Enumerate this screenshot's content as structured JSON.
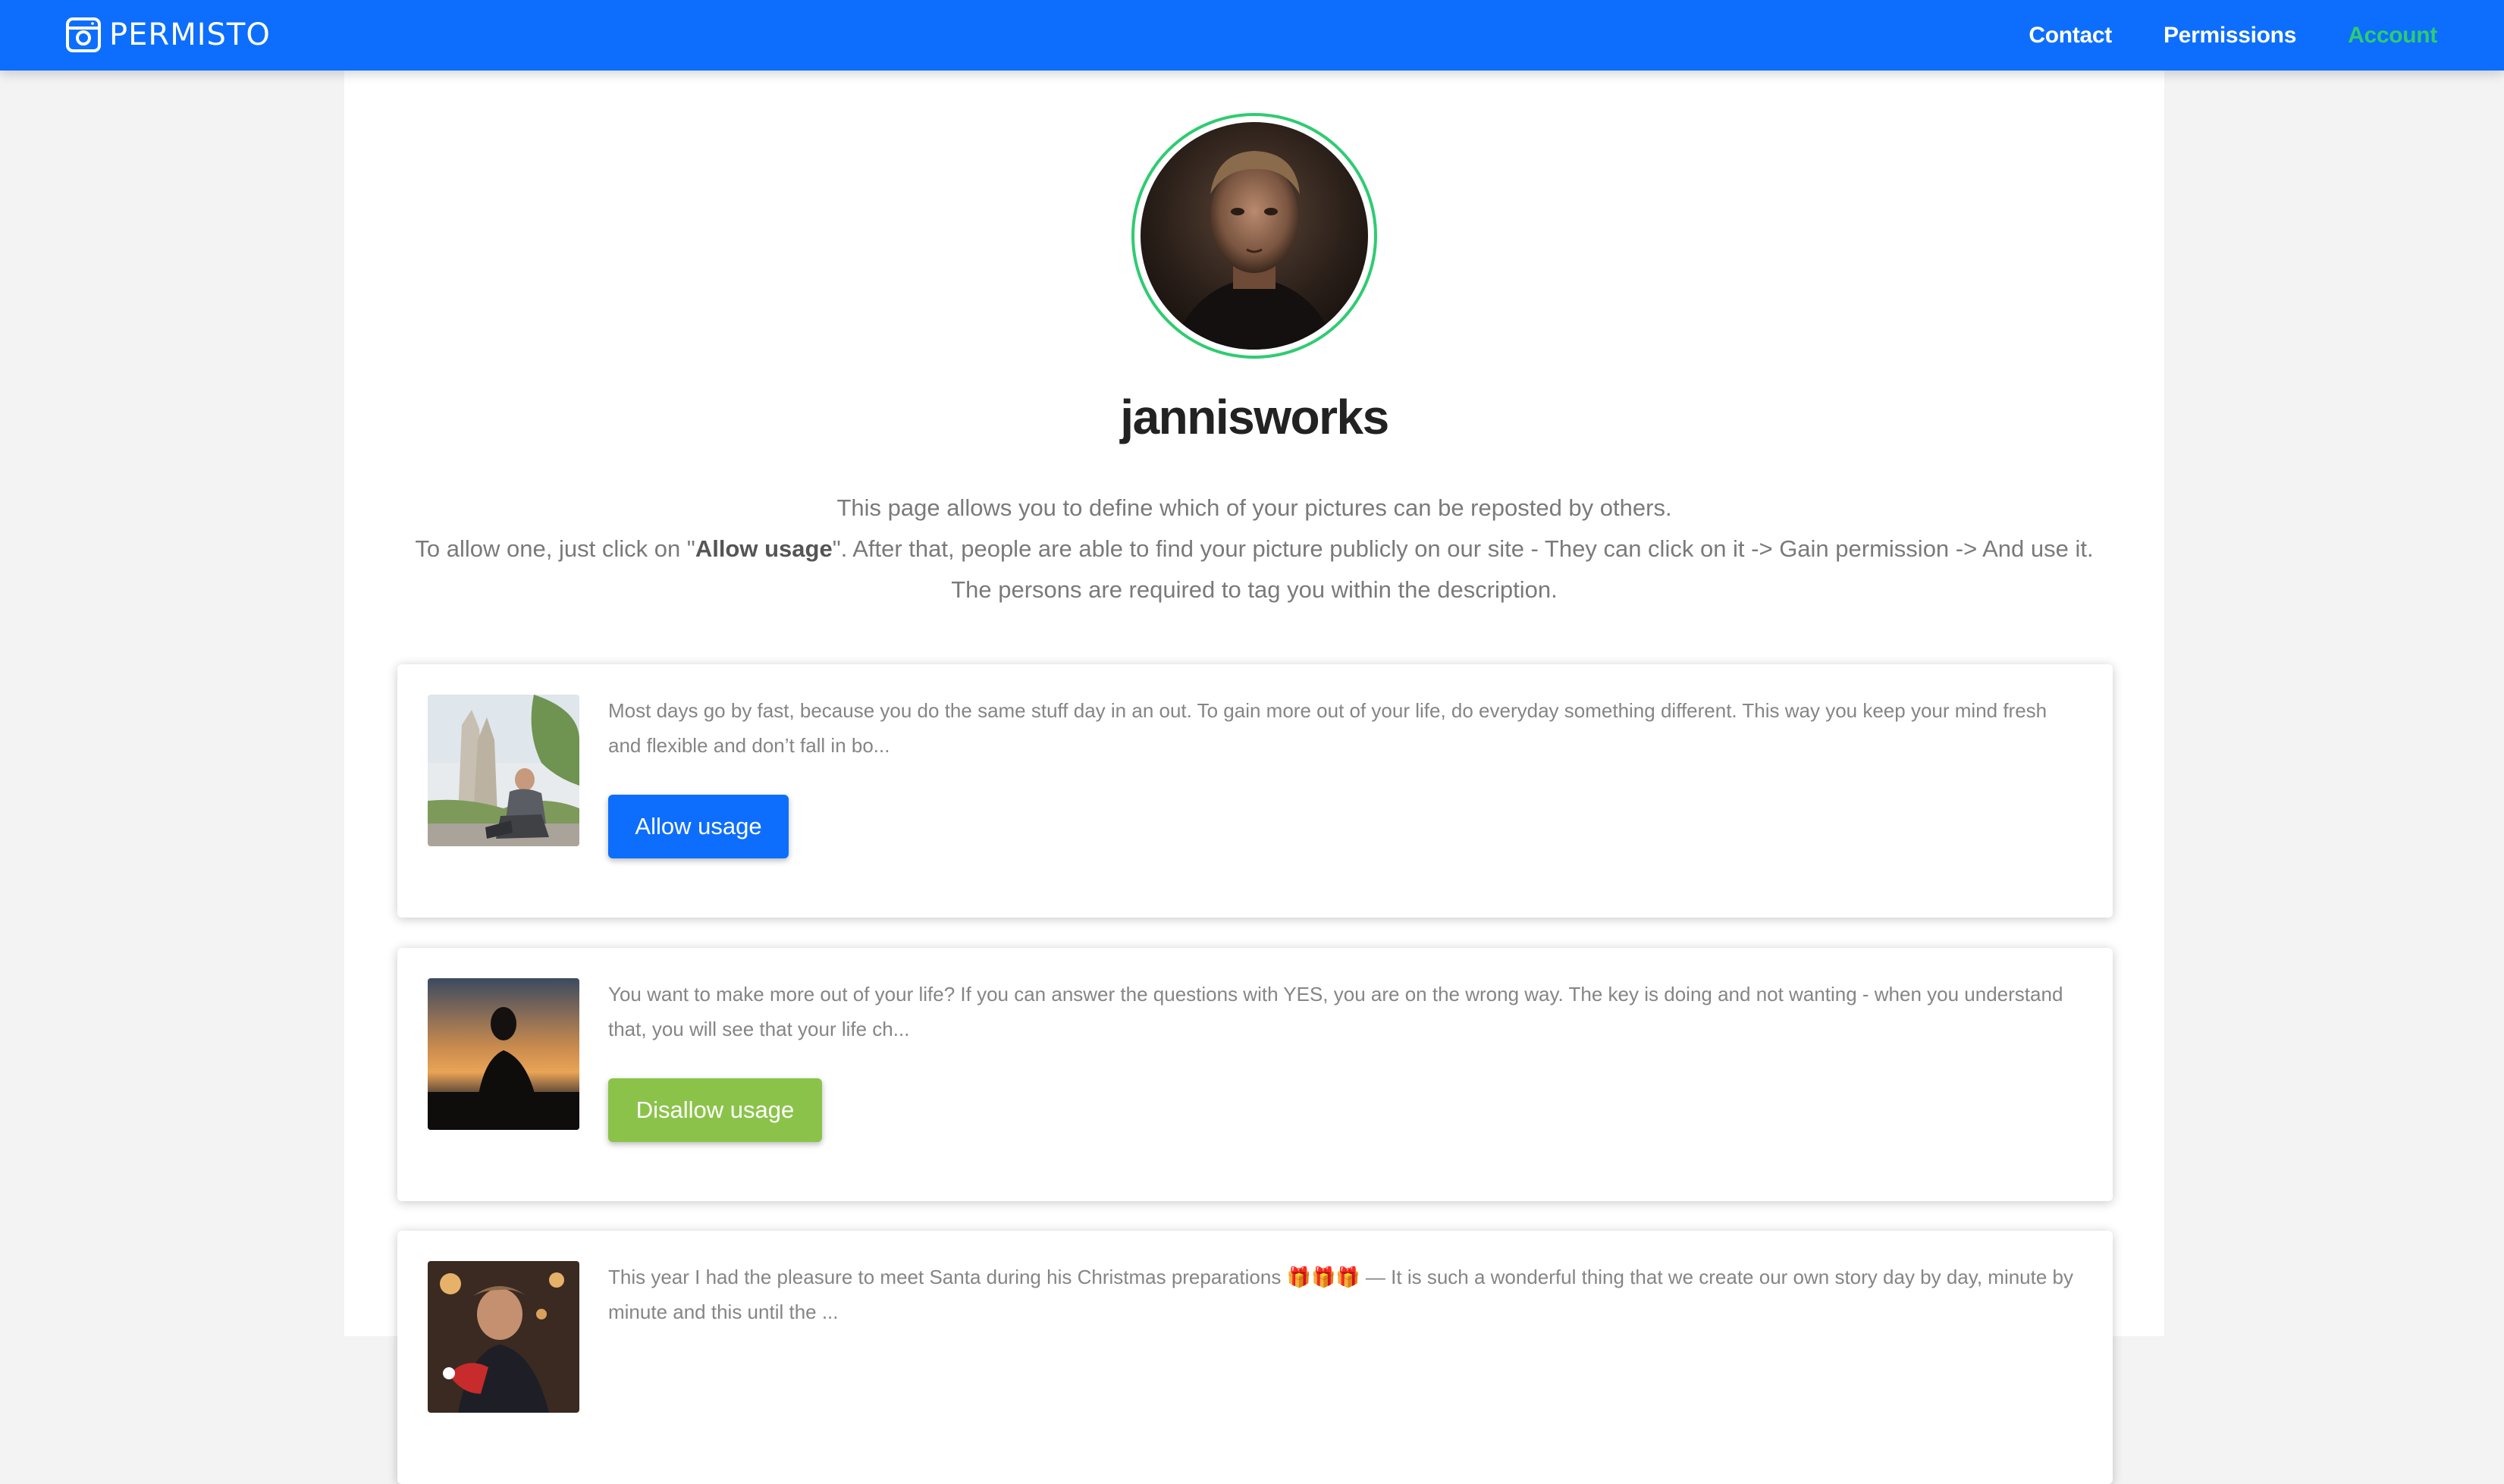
{
  "brand": {
    "name": "PERMISTO"
  },
  "nav": {
    "items": [
      {
        "label": "Contact"
      },
      {
        "label": "Permissions"
      },
      {
        "label": "Account"
      }
    ]
  },
  "profile": {
    "username": "jannisworks"
  },
  "intro": {
    "line1": "This page allows you to define which of your pictures can be reposted by others.",
    "line2_prefix": "To allow one, just click on \"",
    "line2_bold": "Allow usage",
    "line2_suffix": "\". After that, people are able to find your picture publicly on our site - They can click on it -> Gain permission -> And use it.",
    "line3": "The persons are required to tag you within the description."
  },
  "posts": [
    {
      "description": "Most days go by fast, because you do the same stuff day in an out. To gain more out of your life, do everyday something different. This way you keep your mind fresh and flexible and don’t fall in bo...",
      "button_label": "Allow usage"
    },
    {
      "description": "You want to make more out of your life? If you can answer the questions with YES, you are on the wrong way. The key is doing and not wanting - when you understand that, you will see that your life ch...",
      "button_label": "Disallow usage"
    },
    {
      "description": "This year I had the pleasure to meet Santa during his Christmas preparations 🎁🎁🎁 — It is such a wonderful thing that we create our own story day by day, minute by minute and this until the ..."
    }
  ],
  "colors": {
    "nav_bg": "#0d6efd",
    "accent_green": "#2ecc71",
    "allow_button": "#0d6efd",
    "disallow_button": "#8bc34a"
  }
}
